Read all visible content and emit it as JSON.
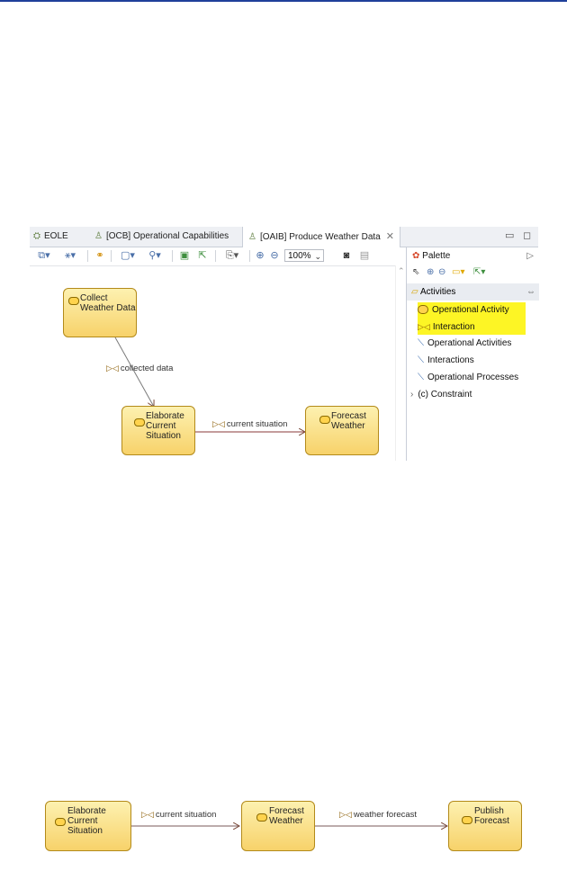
{
  "tabs": [
    {
      "label": "EOLE"
    },
    {
      "label": "[OCB] Operational Capabilities"
    },
    {
      "label": "[OAIB]  Produce Weather Data"
    }
  ],
  "toolbar": {
    "zoom": "100%"
  },
  "palette": {
    "title": "Palette",
    "drawer": "Activities",
    "items": [
      {
        "label": "Operational Activity"
      },
      {
        "label": "Interaction"
      },
      {
        "label": "Operational Activities"
      },
      {
        "label": "Interactions"
      },
      {
        "label": "Operational Processes"
      }
    ],
    "constraint": "(c) Constraint"
  },
  "diagram1": {
    "nodes": [
      {
        "label": "Collect\nWeather Data"
      },
      {
        "label": "Elaborate\nCurrent\nSituation"
      },
      {
        "label": "Forecast\nWeather"
      }
    ],
    "edges": [
      {
        "label": "collected data"
      },
      {
        "label": "current situation"
      }
    ]
  },
  "diagram2": {
    "nodes": [
      {
        "label": "Elaborate\nCurrent\nSituation"
      },
      {
        "label": "Forecast\nWeather"
      },
      {
        "label": "Publish\nForecast"
      }
    ],
    "edges": [
      {
        "label": "current situation"
      },
      {
        "label": "weather forecast"
      }
    ]
  }
}
